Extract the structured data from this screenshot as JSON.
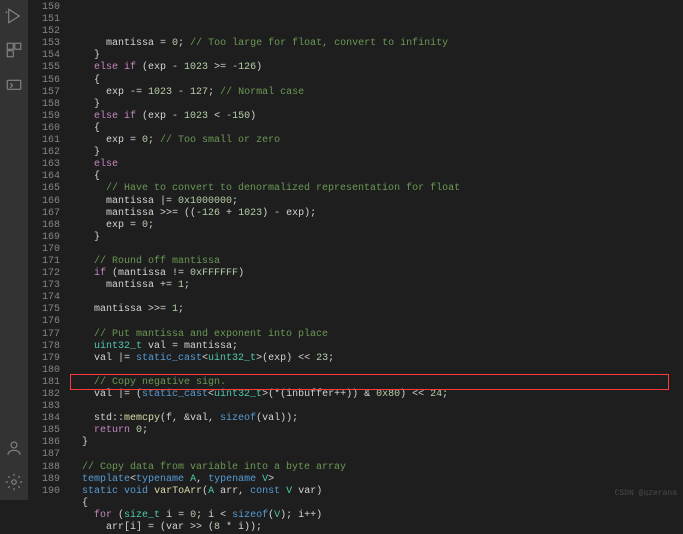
{
  "activity": {
    "run": "run-debug-icon",
    "extensions": "extensions-icon",
    "remote": "remote-icon",
    "account": "account-icon",
    "settings": "gear-icon"
  },
  "gutter": {
    "start": 150,
    "end": 190
  },
  "code": {
    "l150": {
      "a": "      mantissa = ",
      "b": "0",
      "c": "; ",
      "d": "// Too large for float, convert to infinity"
    },
    "l151": {
      "a": "    }"
    },
    "l152": {
      "a": "    ",
      "b": "else if",
      "c": " (exp - ",
      "d": "1023",
      "e": " >= ",
      "f": "-126",
      "g": ")"
    },
    "l153": {
      "a": "    {"
    },
    "l154": {
      "a": "      exp -= ",
      "b": "1023",
      "c": " - ",
      "d": "127",
      "e": "; ",
      "f": "// Normal case"
    },
    "l155": {
      "a": "    }"
    },
    "l156": {
      "a": "    ",
      "b": "else if",
      "c": " (exp - ",
      "d": "1023",
      "e": " < ",
      "f": "-150",
      "g": ")"
    },
    "l157": {
      "a": "    {"
    },
    "l158": {
      "a": "      exp = ",
      "b": "0",
      "c": "; ",
      "d": "// Too small or zero"
    },
    "l159": {
      "a": "    }"
    },
    "l160": {
      "a": "    ",
      "b": "else"
    },
    "l161": {
      "a": "    {"
    },
    "l162": {
      "a": "      ",
      "b": "// Have to convert to denormalized representation for float"
    },
    "l163": {
      "a": "      mantissa |= ",
      "b": "0x1000000",
      "c": ";"
    },
    "l164": {
      "a": "      mantissa >>= ((",
      "b": "-126",
      "c": " + ",
      "d": "1023",
      "e": ") - exp);"
    },
    "l165": {
      "a": "      exp = ",
      "b": "0",
      "c": ";"
    },
    "l166": {
      "a": "    }"
    },
    "l167": {
      "a": ""
    },
    "l168": {
      "a": "    ",
      "b": "// Round off mantissa"
    },
    "l169": {
      "a": "    ",
      "b": "if",
      "c": " (mantissa != ",
      "d": "0xFFFFFF",
      "e": ")"
    },
    "l170": {
      "a": "      mantissa += ",
      "b": "1",
      "c": ";"
    },
    "l171": {
      "a": ""
    },
    "l172": {
      "a": "    mantissa >>= ",
      "b": "1",
      "c": ";"
    },
    "l173": {
      "a": ""
    },
    "l174": {
      "a": "    ",
      "b": "// Put mantissa and exponent into place"
    },
    "l175": {
      "a": "    ",
      "b": "uint32_t",
      "c": " val = mantissa;"
    },
    "l176": {
      "a": "    val |= ",
      "b": "static_cast",
      "c": "<",
      "d": "uint32_t",
      "e": ">(exp) << ",
      "f": "23",
      "g": ";"
    },
    "l177": {
      "a": ""
    },
    "l178": {
      "a": "    ",
      "b": "// Copy negative sign."
    },
    "l179": {
      "a": "    val |= (",
      "b": "static_cast",
      "c": "<",
      "d": "uint32_t",
      "e": ">(*(inbuffer++)) & ",
      "f": "0x80",
      "g": ") << ",
      "h": "24",
      "i": ";"
    },
    "l180": {
      "a": ""
    },
    "l181": {
      "a": "    std::",
      "b": "memcpy",
      "c": "(f, &val, ",
      "d": "sizeof",
      "e": "(val));"
    },
    "l182": {
      "a": "    ",
      "b": "return",
      "c": " ",
      "d": "0",
      "e": ";"
    },
    "l183": {
      "a": "  }"
    },
    "l184": {
      "a": ""
    },
    "l185": {
      "a": "  ",
      "b": "// Copy data from variable into a byte array"
    },
    "l186": {
      "a": "  ",
      "b": "template",
      "c": "<",
      "d": "typename",
      "e": " ",
      "f": "A",
      "g": ", ",
      "h": "typename",
      "i": " ",
      "j": "V",
      "k": ">"
    },
    "l187": {
      "a": "  ",
      "b": "static",
      "c": " ",
      "d": "void",
      "e": " ",
      "f": "varToArr",
      "g": "(",
      "h": "A",
      "i": " arr, ",
      "j": "const",
      "k": " ",
      "l": "V",
      "m": " var)"
    },
    "l188": {
      "a": "  {"
    },
    "l189": {
      "a": "    ",
      "b": "for",
      "c": " (",
      "d": "size_t",
      "e": " i = ",
      "f": "0",
      "g": "; i < ",
      "h": "sizeof",
      "i": "(",
      "j": "V",
      "k": "); i++)"
    },
    "l190": {
      "a": "      arr[i] = (var >> (",
      "b": "8",
      "c": " * i));"
    }
  },
  "watermark": "CSDN @qzerana"
}
